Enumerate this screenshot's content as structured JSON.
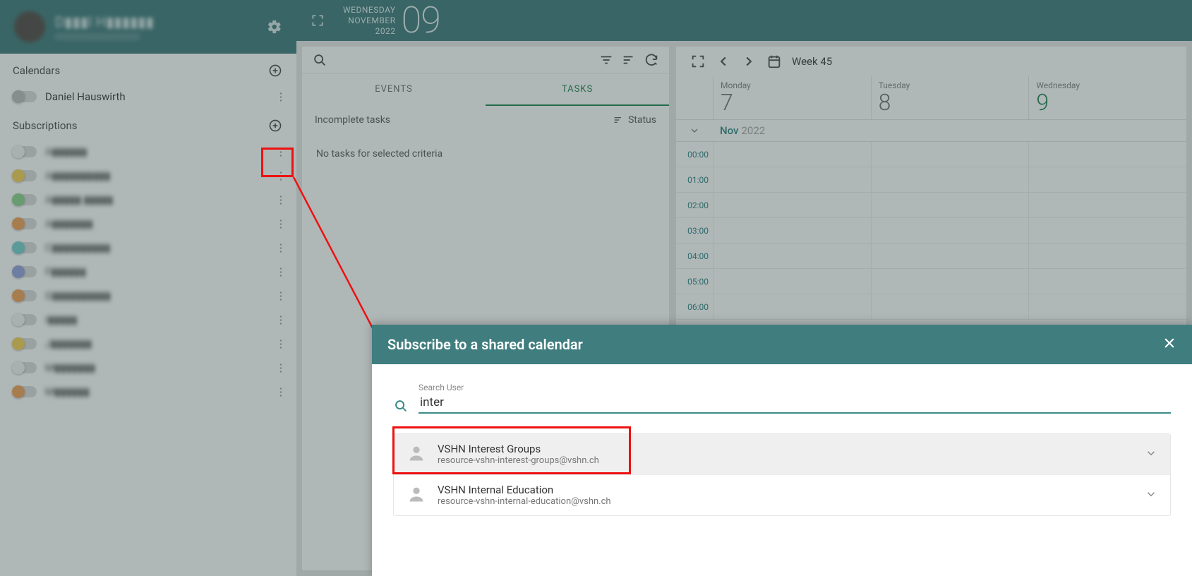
{
  "user": {
    "name": "D▮▮▮l H▮▮▮▮▮▮"
  },
  "sidebar": {
    "calendars_label": "Calendars",
    "subscriptions_label": "Subscriptions",
    "own_calendar": "Daniel Hauswirth",
    "subs": [
      {
        "label": "A▮▮▮▮▮▮",
        "color": "white"
      },
      {
        "label": "A▮▮▮▮▮▮▮▮▮▮",
        "color": "yellow"
      },
      {
        "label": "A▮▮▮▮▮  ▮▮▮▮▮",
        "color": "green"
      },
      {
        "label": "A▮▮▮▮▮▮▮",
        "color": "orange"
      },
      {
        "label": "C▮▮▮▮▮▮▮▮▮▮",
        "color": "teal"
      },
      {
        "label": "F▮▮▮▮▮▮",
        "color": "blue"
      },
      {
        "label": "G▮▮▮▮▮▮▮▮▮▮",
        "color": "orange"
      },
      {
        "label": "I▮▮▮▮▮",
        "color": "white"
      },
      {
        "label": "J▮▮▮▮▮▮▮",
        "color": "yellow"
      },
      {
        "label": "M▮▮▮▮▮▮▮",
        "color": "white"
      },
      {
        "label": "M▮▮▮▮▮▮",
        "color": "orange"
      }
    ]
  },
  "header": {
    "weekday": "WEDNESDAY",
    "month": "NOVEMBER",
    "year": "2022",
    "daynum": "09"
  },
  "tasks": {
    "tab_events": "EVENTS",
    "tab_tasks": "TASKS",
    "incomplete_label": "Incomplete tasks",
    "status_label": "Status",
    "empty": "No tasks for selected criteria"
  },
  "calendar": {
    "week_label": "Week 45",
    "month": "Nov",
    "year": "2022",
    "days": [
      {
        "name": "Monday",
        "num": "7",
        "today": false
      },
      {
        "name": "Tuesday",
        "num": "8",
        "today": false
      },
      {
        "name": "Wednesday",
        "num": "9",
        "today": true
      }
    ],
    "hours": [
      "00:00",
      "01:00",
      "02:00",
      "03:00",
      "04:00",
      "05:00",
      "06:00"
    ]
  },
  "dialog": {
    "title": "Subscribe to a shared calendar",
    "search_label": "Search User",
    "search_value": "inter",
    "results": [
      {
        "title": "VSHN Interest Groups",
        "sub": "resource-vshn-interest-groups@vshn.ch"
      },
      {
        "title": "VSHN Internal Education",
        "sub": "resource-vshn-internal-education@vshn.ch"
      }
    ]
  }
}
